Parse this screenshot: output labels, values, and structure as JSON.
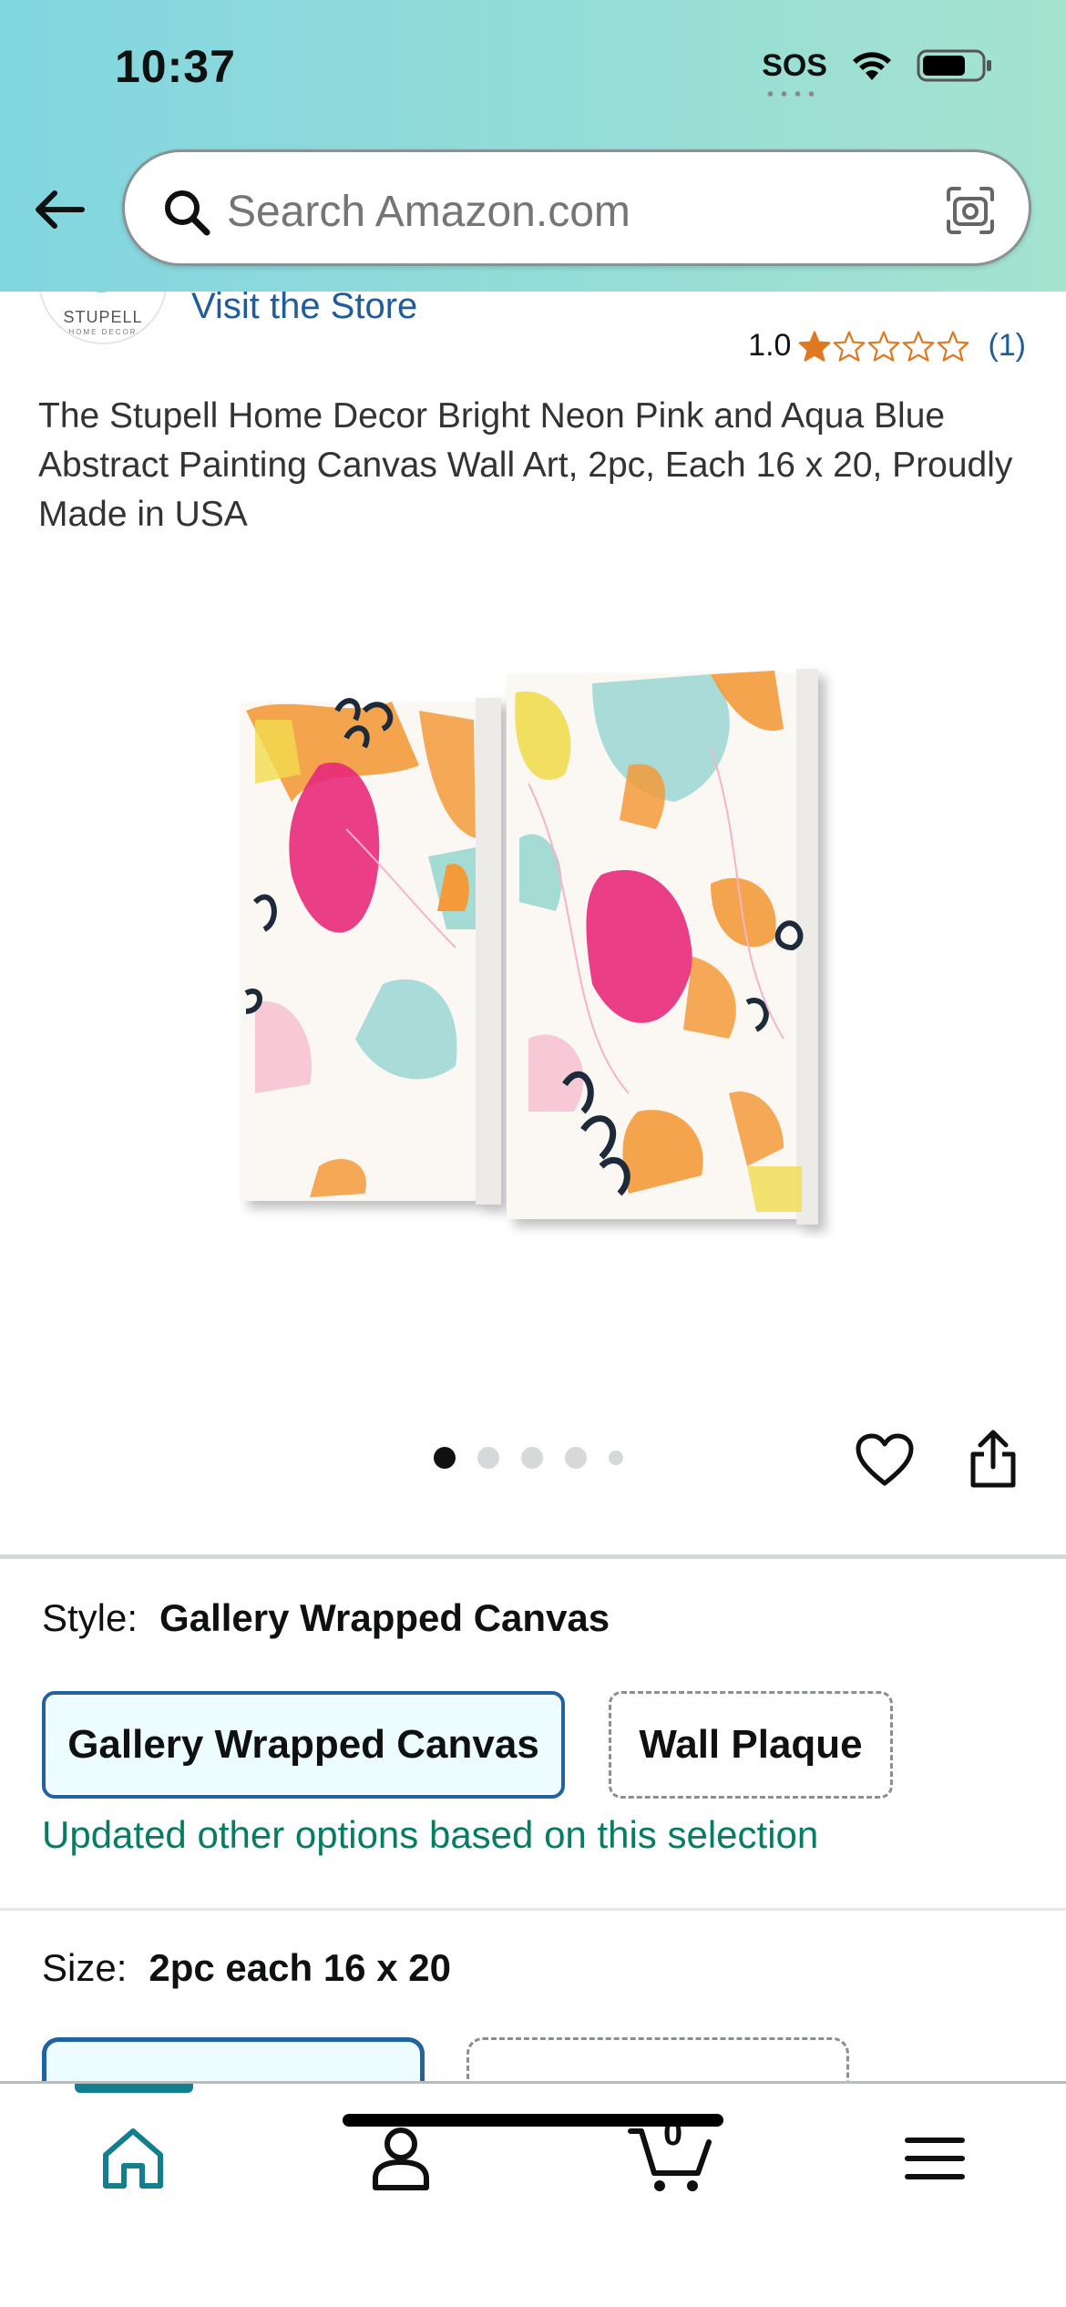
{
  "status_bar": {
    "time": "10:37",
    "sos": "SOS"
  },
  "search": {
    "placeholder": "Search Amazon.com"
  },
  "store": {
    "logo_text": "STUPELL",
    "logo_subtext": "HOME DECOR",
    "link_label": "Visit the Store"
  },
  "rating": {
    "value": "1.0",
    "stars_filled": 1,
    "stars_total": 5,
    "count": "(1)"
  },
  "product": {
    "title": "The Stupell Home Decor Bright Neon Pink and Aqua Blue Abstract Painting Canvas Wall Art, 2pc, Each 16 x 20, Proudly Made in USA",
    "image_count": 5,
    "active_image": 1
  },
  "style": {
    "label": "Style:",
    "value": "Gallery Wrapped Canvas",
    "options": [
      "Gallery Wrapped Canvas",
      "Wall Plaque"
    ],
    "selected": "Gallery Wrapped Canvas",
    "note": "Updated other options based on this selection"
  },
  "size": {
    "label": "Size:",
    "value": "2pc each 16 x 20"
  },
  "bottom_nav": {
    "cart_count": "0",
    "items": [
      "home-icon",
      "account-icon",
      "cart-icon",
      "menu-icon"
    ]
  },
  "colors": {
    "link": "#1f5c99",
    "accent": "#137f8e",
    "selected_border": "#2162a1",
    "success": "#067d62",
    "star": "#de7921"
  }
}
